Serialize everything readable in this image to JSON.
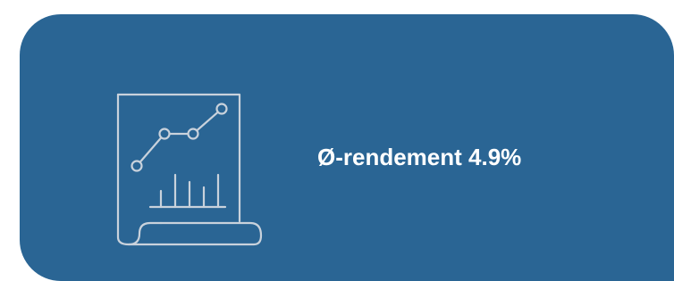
{
  "card": {
    "background": "#2a6594",
    "icon": "report-chart-icon",
    "icon_color": "#c9d2dc",
    "stat_text": "Ø-rendement 4.9%"
  }
}
